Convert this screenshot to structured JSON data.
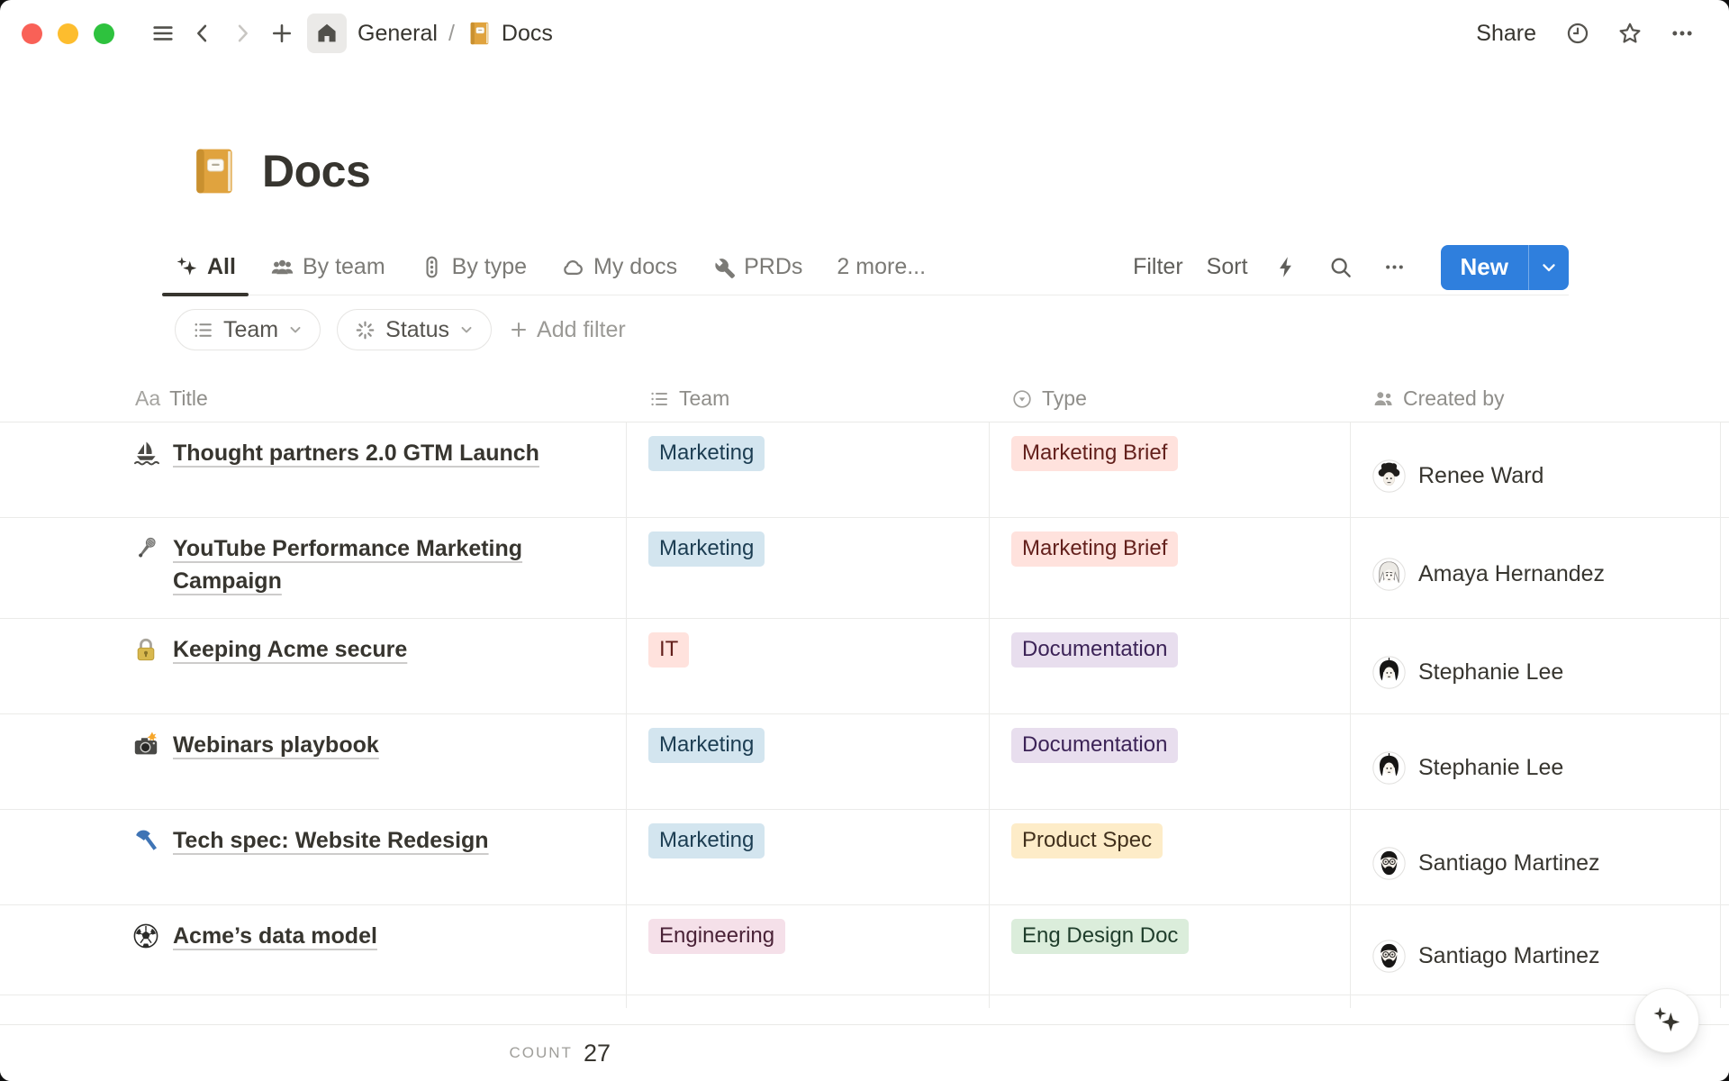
{
  "colors": {
    "accent_blue": "#2f7fdd",
    "tag": {
      "blue": {
        "bg": "#d3e5ef",
        "text": "#1c3d52"
      },
      "light_red": {
        "bg": "#ffe2dd",
        "text": "#63201c"
      },
      "purple": {
        "bg": "#e8deee",
        "text": "#3c2357"
      },
      "yellow": {
        "bg": "#fdecc8",
        "text": "#41301c"
      },
      "green": {
        "bg": "#dbeddb",
        "text": "#1f3d2b"
      },
      "pink": {
        "bg": "#f5e0e9",
        "text": "#4a2237"
      }
    }
  },
  "topbar": {
    "breadcrumb": {
      "root": "General",
      "separator": "/",
      "page": "Docs",
      "page_icon": "ledger"
    },
    "share_label": "Share"
  },
  "page": {
    "title": "Docs",
    "icon": "ledger"
  },
  "views": {
    "tabs": [
      {
        "label": "All",
        "icon": "sparkles"
      },
      {
        "label": "By team",
        "icon": "people"
      },
      {
        "label": "By type",
        "icon": "traffic-light"
      },
      {
        "label": "My docs",
        "icon": "cloud"
      },
      {
        "label": "PRDs",
        "icon": "wrench"
      },
      {
        "label": "2 more...",
        "icon": ""
      }
    ]
  },
  "toolbar": {
    "filter_label": "Filter",
    "sort_label": "Sort",
    "new_label": "New"
  },
  "filter_bar": {
    "chips": [
      {
        "label": "Team",
        "icon": "list"
      },
      {
        "label": "Status",
        "icon": "status"
      }
    ],
    "add_filter_label": "Add filter"
  },
  "table": {
    "columns": [
      {
        "label": "Title",
        "icon": "text"
      },
      {
        "label": "Team",
        "icon": "list"
      },
      {
        "label": "Type",
        "icon": "select"
      },
      {
        "label": "Created by",
        "icon": "people-pair"
      }
    ],
    "rows": [
      {
        "icon": "sailboat",
        "title": "Thought partners 2.0 GTM Launch",
        "team": {
          "label": "Marketing",
          "color": "blue"
        },
        "type": {
          "label": "Marketing Brief",
          "color": "light_red"
        },
        "created_by": {
          "name": "Renee Ward",
          "avatar": "renee"
        }
      },
      {
        "icon": "microphone",
        "title": "YouTube Performance Marketing Campaign",
        "team": {
          "label": "Marketing",
          "color": "blue"
        },
        "type": {
          "label": "Marketing Brief",
          "color": "light_red"
        },
        "created_by": {
          "name": "Amaya Hernandez",
          "avatar": "amaya"
        }
      },
      {
        "icon": "lock",
        "title": "Keeping Acme secure",
        "team": {
          "label": "IT",
          "color": "light_red"
        },
        "type": {
          "label": "Documentation",
          "color": "purple"
        },
        "created_by": {
          "name": "Stephanie Lee",
          "avatar": "stephanie"
        }
      },
      {
        "icon": "camera-flash",
        "title": "Webinars playbook",
        "team": {
          "label": "Marketing",
          "color": "blue"
        },
        "type": {
          "label": "Documentation",
          "color": "purple"
        },
        "created_by": {
          "name": "Stephanie Lee",
          "avatar": "stephanie"
        }
      },
      {
        "icon": "hammer",
        "title": "Tech spec: Website Redesign",
        "team": {
          "label": "Marketing",
          "color": "blue"
        },
        "type": {
          "label": "Product Spec",
          "color": "yellow"
        },
        "created_by": {
          "name": "Santiago Martinez",
          "avatar": "santiago"
        }
      },
      {
        "icon": "soccer-ball",
        "title": "Acme’s data model",
        "team": {
          "label": "Engineering",
          "color": "pink"
        },
        "type": {
          "label": "Eng Design Doc",
          "color": "green"
        },
        "created_by": {
          "name": "Santiago Martinez",
          "avatar": "santiago"
        }
      }
    ],
    "footer": {
      "count_label": "COUNT",
      "count_value": "27"
    }
  }
}
